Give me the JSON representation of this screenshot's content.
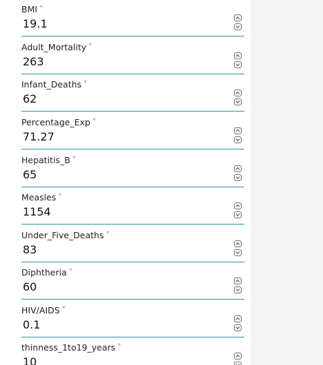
{
  "required_marker": "*",
  "fields": [
    {
      "label": "BMI",
      "value": "19.1"
    },
    {
      "label": "Adult_Mortality",
      "value": "263"
    },
    {
      "label": "Infant_Deaths",
      "value": "62"
    },
    {
      "label": "Percentage_Exp",
      "value": "71.27"
    },
    {
      "label": "Hepatitis_B",
      "value": "65"
    },
    {
      "label": "Measles",
      "value": "1154"
    },
    {
      "label": "Under_Five_Deaths",
      "value": "83"
    },
    {
      "label": "Diphtheria",
      "value": "60"
    },
    {
      "label": "HIV/AIDS",
      "value": "0.1"
    },
    {
      "label": "thinness_1to19_years",
      "value": "10"
    }
  ],
  "icons": {
    "increment": "chevron-up-icon",
    "decrement": "chevron-down-icon"
  },
  "colors": {
    "underline": "#2d8fa8",
    "page_background": "#f3f3f3",
    "form_background": "#ffffff"
  }
}
